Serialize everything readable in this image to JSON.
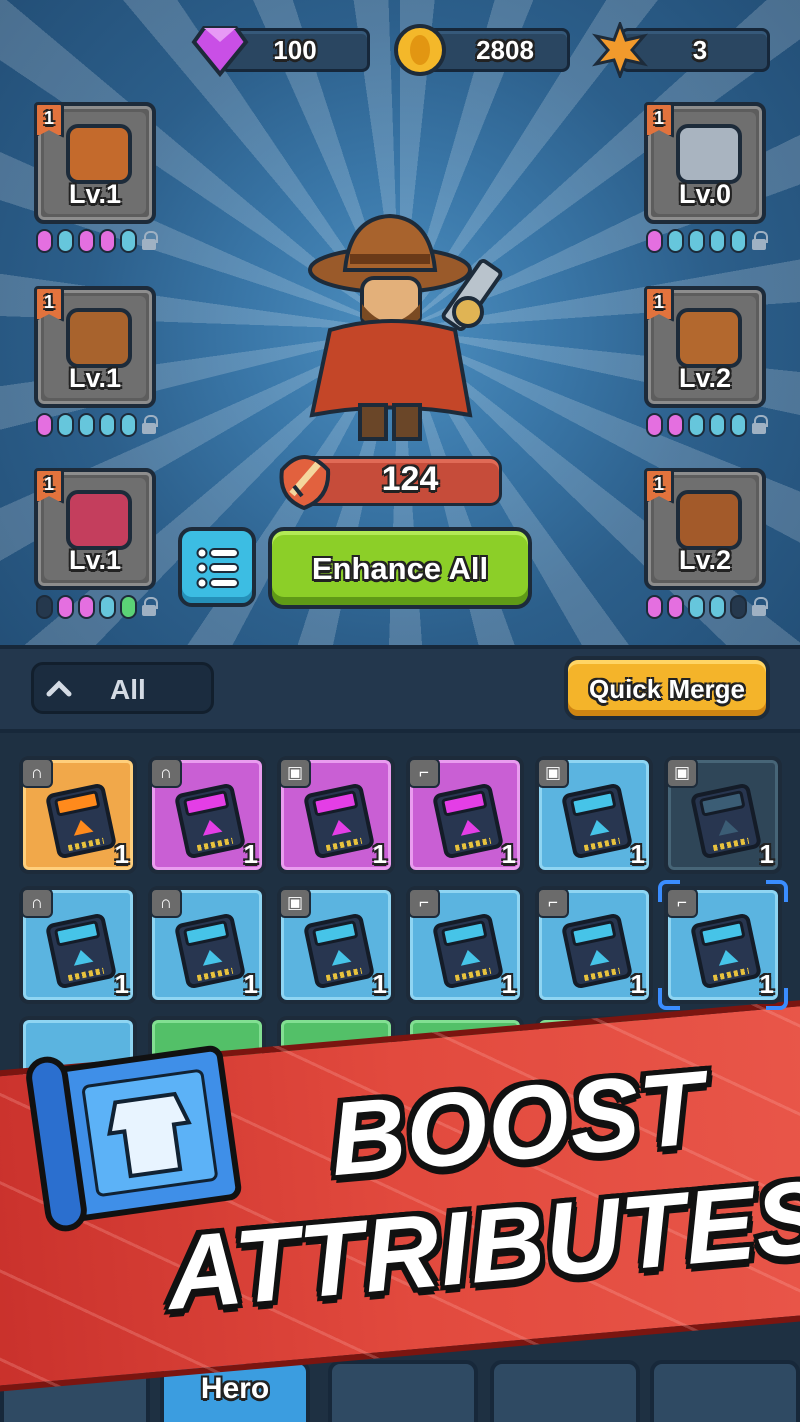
{
  "currencies": {
    "gems": {
      "icon": "gem-icon",
      "value": "100"
    },
    "coins": {
      "icon": "coin-icon",
      "value": "2808"
    },
    "stars": {
      "icon": "star-badge-icon",
      "value": "3"
    }
  },
  "equipment": {
    "left": [
      {
        "slot": "armor",
        "icon": "vest-icon",
        "rank": "1",
        "level": "Lv.1",
        "pips": [
          "pink",
          "cyan",
          "pink",
          "pink",
          "cyan"
        ]
      },
      {
        "slot": "hat",
        "icon": "cowboy-hat-icon",
        "rank": "1",
        "level": "Lv.1",
        "pips": [
          "pink",
          "cyan",
          "cyan",
          "cyan",
          "cyan"
        ]
      },
      {
        "slot": "cape",
        "icon": "poncho-icon",
        "rank": "1",
        "level": "Lv.1",
        "pips": [
          "dark",
          "pink",
          "pink",
          "cyan",
          "green"
        ]
      }
    ],
    "right": [
      {
        "slot": "weapon",
        "icon": "revolver-icon",
        "rank": "1",
        "level": "Lv.0",
        "pips": [
          "pink",
          "cyan",
          "cyan",
          "cyan",
          "cyan"
        ]
      },
      {
        "slot": "belt",
        "icon": "belt-icon",
        "rank": "1",
        "level": "Lv.2",
        "pips": [
          "pink",
          "pink",
          "cyan",
          "cyan",
          "cyan"
        ]
      },
      {
        "slot": "boots",
        "icon": "boot-icon",
        "rank": "1",
        "level": "Lv.2",
        "pips": [
          "pink",
          "pink",
          "cyan",
          "cyan",
          "dark"
        ]
      }
    ]
  },
  "hero": {
    "name_icon": "cowboy-hero-art",
    "power_icon": "swords-icon",
    "power": "124"
  },
  "actions": {
    "enhance_label": "Enhance All",
    "list_icon": "list-icon"
  },
  "filter": {
    "selected": "All",
    "quick_merge_label": "Quick Merge"
  },
  "inventory": [
    [
      {
        "type": "hat",
        "rarity": "orange",
        "count": "1"
      },
      {
        "type": "hat",
        "rarity": "purple",
        "count": "1"
      },
      {
        "type": "armor",
        "rarity": "purple",
        "count": "1"
      },
      {
        "type": "gun",
        "rarity": "purple",
        "count": "1"
      },
      {
        "type": "armor",
        "rarity": "blue",
        "count": "1"
      },
      {
        "type": "armor",
        "rarity": "dim",
        "count": "1"
      }
    ],
    [
      {
        "type": "hat",
        "rarity": "blue",
        "count": "1"
      },
      {
        "type": "hat",
        "rarity": "blue",
        "count": "1"
      },
      {
        "type": "armor",
        "rarity": "blue",
        "count": "1"
      },
      {
        "type": "gun",
        "rarity": "blue",
        "count": "1"
      },
      {
        "type": "gun",
        "rarity": "blue",
        "count": "1"
      },
      {
        "type": "gun",
        "rarity": "blue",
        "count": "1",
        "selected": true
      }
    ]
  ],
  "promo": {
    "line1": "BOOST",
    "line2": "ATTRIBUTES!",
    "icon": "blueprint-scroll-icon"
  },
  "tabs": {
    "hero_label": "Hero"
  }
}
